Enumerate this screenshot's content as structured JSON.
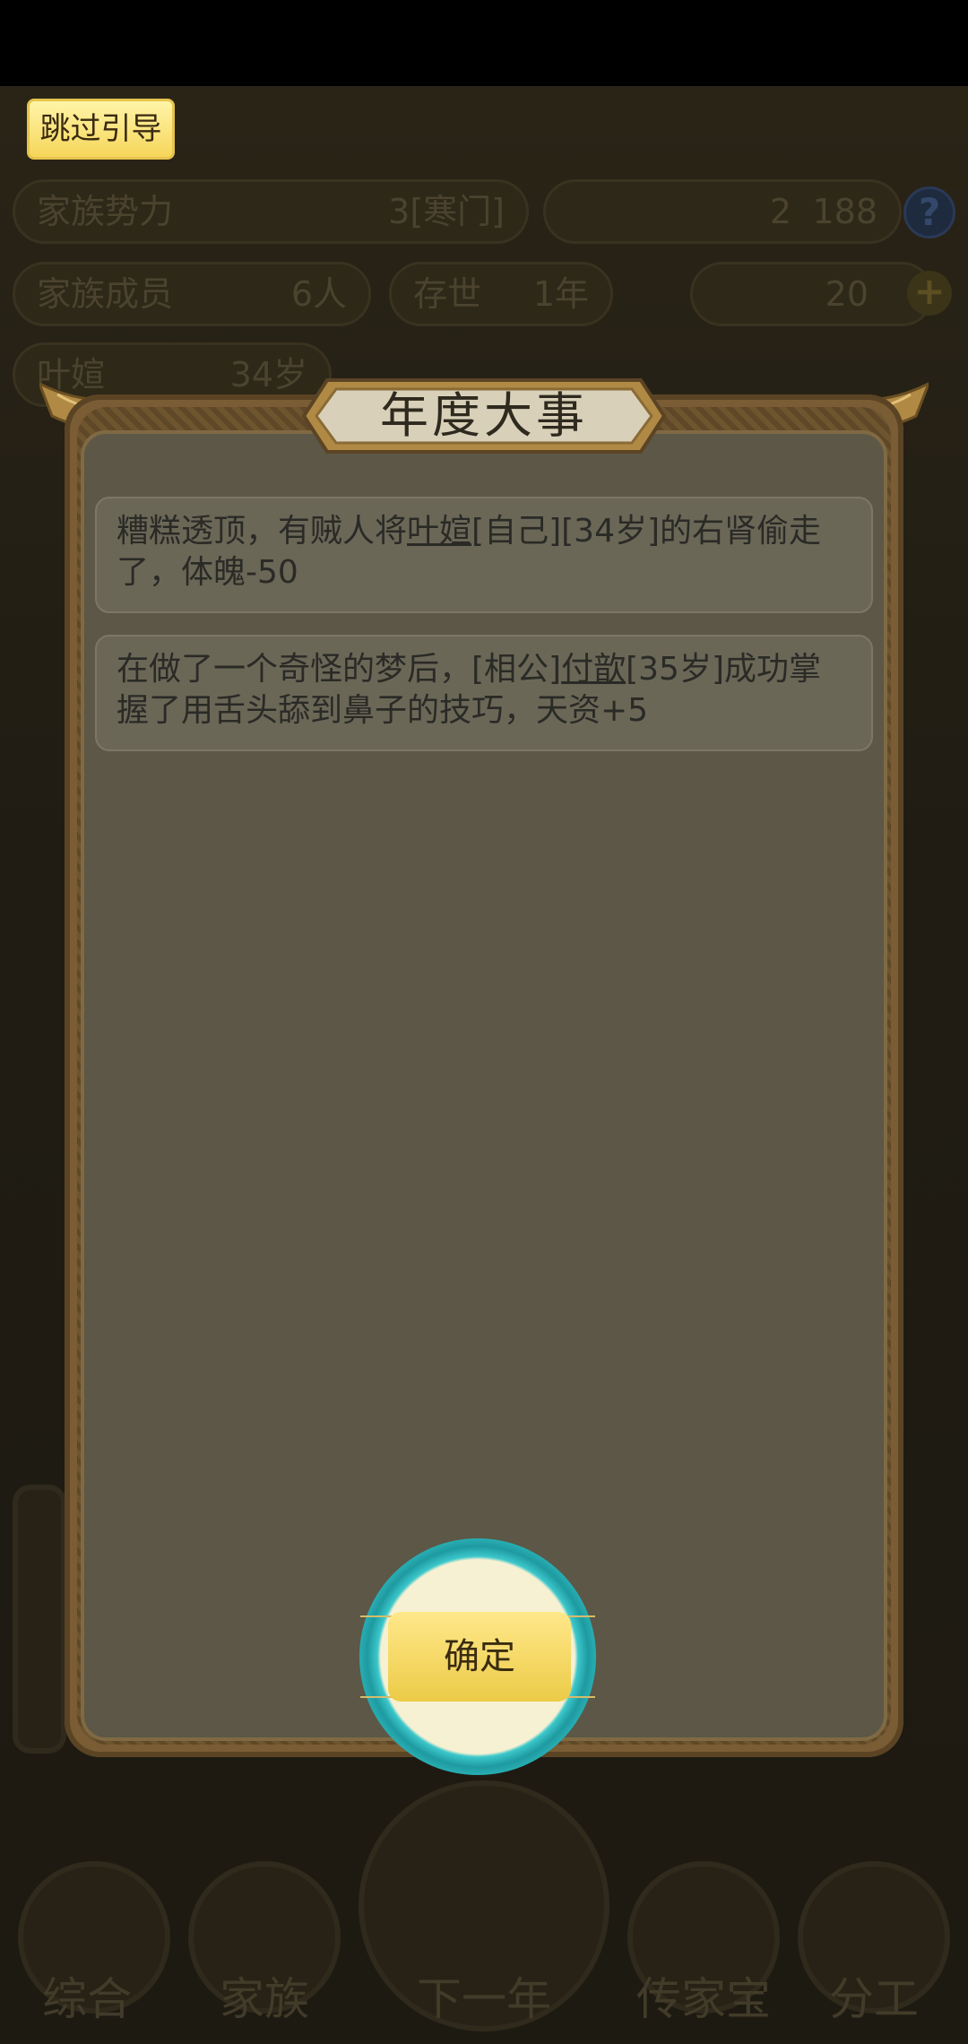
{
  "background": {
    "stats": {
      "power_label": "家族势力",
      "power_value": "3[寒门]",
      "currency_a": "2",
      "currency_b": "188",
      "members_label": "家族成员",
      "members_value": "6人",
      "exist_label": "存世",
      "exist_value": "1年",
      "coins": "20",
      "char_name": "叶媗",
      "char_age": "34岁"
    },
    "tabs": [
      "综合",
      "家族",
      "下一年",
      "传家宝",
      "分工"
    ]
  },
  "guide": {
    "skip_label": "跳过引导"
  },
  "dialog": {
    "title": "年度大事",
    "events": [
      {
        "before": "糟糕透顶，有贼人将",
        "name": "叶媗",
        "after": "[自己][34岁]的右肾偷走了，体魄-50"
      },
      {
        "before": "在做了一个奇怪的梦后，[相公]",
        "name": "付歆",
        "after": "[35岁]成功掌握了用舌头舔到鼻子的技巧，天资+5"
      }
    ],
    "confirm_label": "确定"
  },
  "colors": {
    "accent": "#3bc7cb",
    "button": "#eccb47",
    "panel": "#5c5746"
  }
}
